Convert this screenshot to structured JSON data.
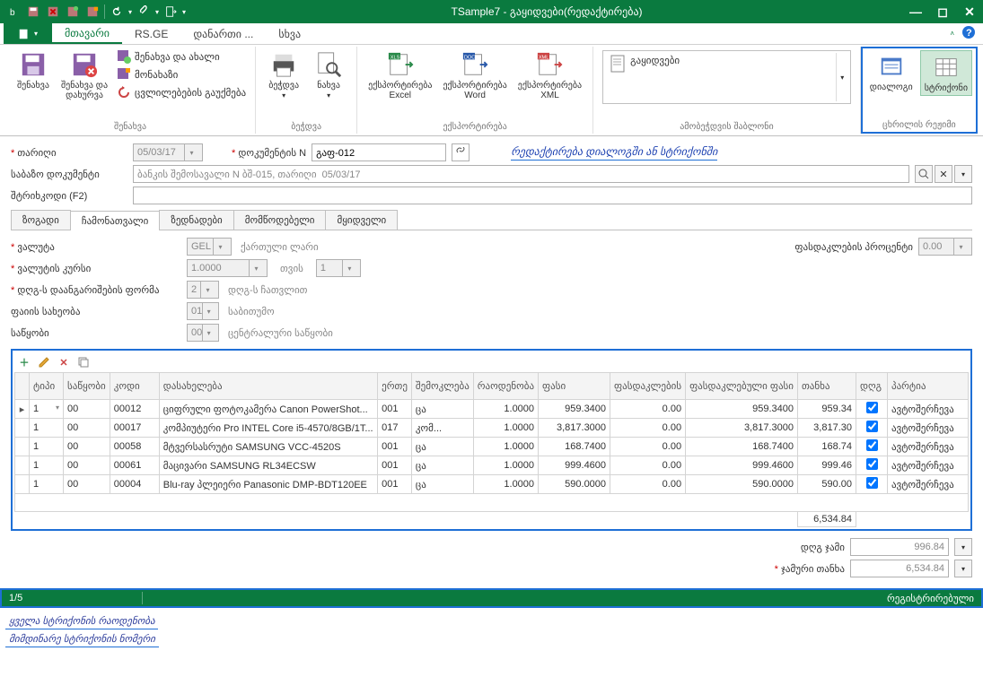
{
  "title": "TSample7 - გაყიდვები(რედაქტირება)",
  "ribbon_tabs": {
    "main": "მთავარი",
    "rsge": "RS.GE",
    "attach": "დანართი ...",
    "other": "სხვა"
  },
  "ribbon": {
    "save_group": {
      "save": "შენახვა",
      "save_close": "შენახვა და\nდახურვა",
      "save_new": "შენახვა და ახალი",
      "template": "მონახაზი",
      "changes_off": "ცვლილებების გაუქმება",
      "label": "შენახვა"
    },
    "print_group": {
      "print": "ბეჭდვა",
      "view": "ნახვა",
      "label": "ბეჭდვა"
    },
    "export_group": {
      "excel": "ექსპორტირება\nExcel",
      "word": "ექსპორტირება\nWord",
      "xml": "ექსპორტირება\nXML",
      "label": "ექსპორტირება"
    },
    "template_group": {
      "item": "გაყიდვები",
      "label": "ამობეჭდვის შაბლონი"
    },
    "view_group": {
      "dialog": "დიალოგი",
      "rows": "სტრიქონი",
      "label": "ცხრილის რეჟიმი"
    }
  },
  "form": {
    "date_label": "თარიღი",
    "date_value": "05/03/17",
    "docnum_label": "დოკუმენტის N",
    "docnum_value": "გაფ-012",
    "hint": "რედაქტირება დიალოგში ან სტრიქონში",
    "base_label": "საბაზო დოკუმენტი",
    "base_value": "ბანკის შემოსავალი N ბშ-015, თარიღი  05/03/17",
    "barcode_label": "შტრიხკოდი (F2)"
  },
  "inner_tabs": {
    "general": "ზოგადი",
    "items": "ჩამონათვალი",
    "extra": "ზედნადები",
    "supplier": "მომწოდებელი",
    "buyer": "მყიდველი"
  },
  "detail": {
    "currency_label": "ვალუტა",
    "currency_code": "GEL",
    "currency_name": "ქართული ლარი",
    "rate_label": "ვალუტის კურსი",
    "rate_value": "1.0000",
    "rate_per_label": "თვის",
    "rate_per_value": "1",
    "vat_label": "დღგ-ს დაანგარიშების ფორმა",
    "vat_value": "2",
    "vat_suffix": "დღგ-ს ჩათვლით",
    "price_type_label": "ფაიის სახეობა",
    "price_type_value": "01",
    "price_type_suffix": "საბითუმო",
    "stock_label": "საწყობი",
    "stock_value": "00",
    "stock_suffix": "ცენტრალური საწყობი",
    "discount_label": "ფასდაკლების პროცენტი",
    "discount_value": "0.00"
  },
  "chart_data": {
    "type": "table",
    "columns": [
      "ტიპი",
      "საწყობი",
      "კოდი",
      "დასახელება",
      "ერთე",
      "შემოკლება",
      "რაოდენობა",
      "ფასი",
      "ფასდაკლების",
      "ფასდაკლებული ფასი",
      "თანხა",
      "დღგ",
      "პარტია"
    ],
    "rows": [
      {
        "type": "1",
        "stock": "00",
        "code": "00012",
        "name": "ციფრული ფოტოკამერა Canon PowerShot...",
        "unit": "001",
        "ushort": "ცა",
        "qty": "1.0000",
        "price": "959.3400",
        "disc": "0.00",
        "dprice": "959.3400",
        "amount": "959.34",
        "vat": true,
        "batch": "ავტოშერჩევა"
      },
      {
        "type": "1",
        "stock": "00",
        "code": "00017",
        "name": "კომპიუტერი Pro INTEL Core i5-4570/8GB/1T...",
        "unit": "017",
        "ushort": "კომ...",
        "qty": "1.0000",
        "price": "3,817.3000",
        "disc": "0.00",
        "dprice": "3,817.3000",
        "amount": "3,817.30",
        "vat": true,
        "batch": "ავტოშერჩევა"
      },
      {
        "type": "1",
        "stock": "00",
        "code": "00058",
        "name": "მტვერსასრუტი SAMSUNG VCC-4520S",
        "unit": "001",
        "ushort": "ცა",
        "qty": "1.0000",
        "price": "168.7400",
        "disc": "0.00",
        "dprice": "168.7400",
        "amount": "168.74",
        "vat": true,
        "batch": "ავტოშერჩევა"
      },
      {
        "type": "1",
        "stock": "00",
        "code": "00061",
        "name": "მაცივარი SAMSUNG RL34ECSW",
        "unit": "001",
        "ushort": "ცა",
        "qty": "1.0000",
        "price": "999.4600",
        "disc": "0.00",
        "dprice": "999.4600",
        "amount": "999.46",
        "vat": true,
        "batch": "ავტოშერჩევა"
      },
      {
        "type": "1",
        "stock": "00",
        "code": "00004",
        "name": "Blu-ray პლეიერი Panasonic DMP-BDT120EE",
        "unit": "001",
        "ushort": "ცა",
        "qty": "1.0000",
        "price": "590.0000",
        "disc": "0.00",
        "dprice": "590.0000",
        "amount": "590.00",
        "vat": true,
        "batch": "ავტოშერჩევა"
      }
    ],
    "sum_amount": "6,534.84"
  },
  "totals": {
    "vat_label": "დღგ ჯამი",
    "vat_value": "996.84",
    "total_label": "ჯამური თანხა",
    "total_value": "6,534.84"
  },
  "status": {
    "pos": "1/5",
    "state": "რეგისტრირებული"
  },
  "legend": {
    "l1": "ყველა სტრიქონის რაოდენობა",
    "l2": "მიმდინარე სტრიქონის ნომერი"
  }
}
